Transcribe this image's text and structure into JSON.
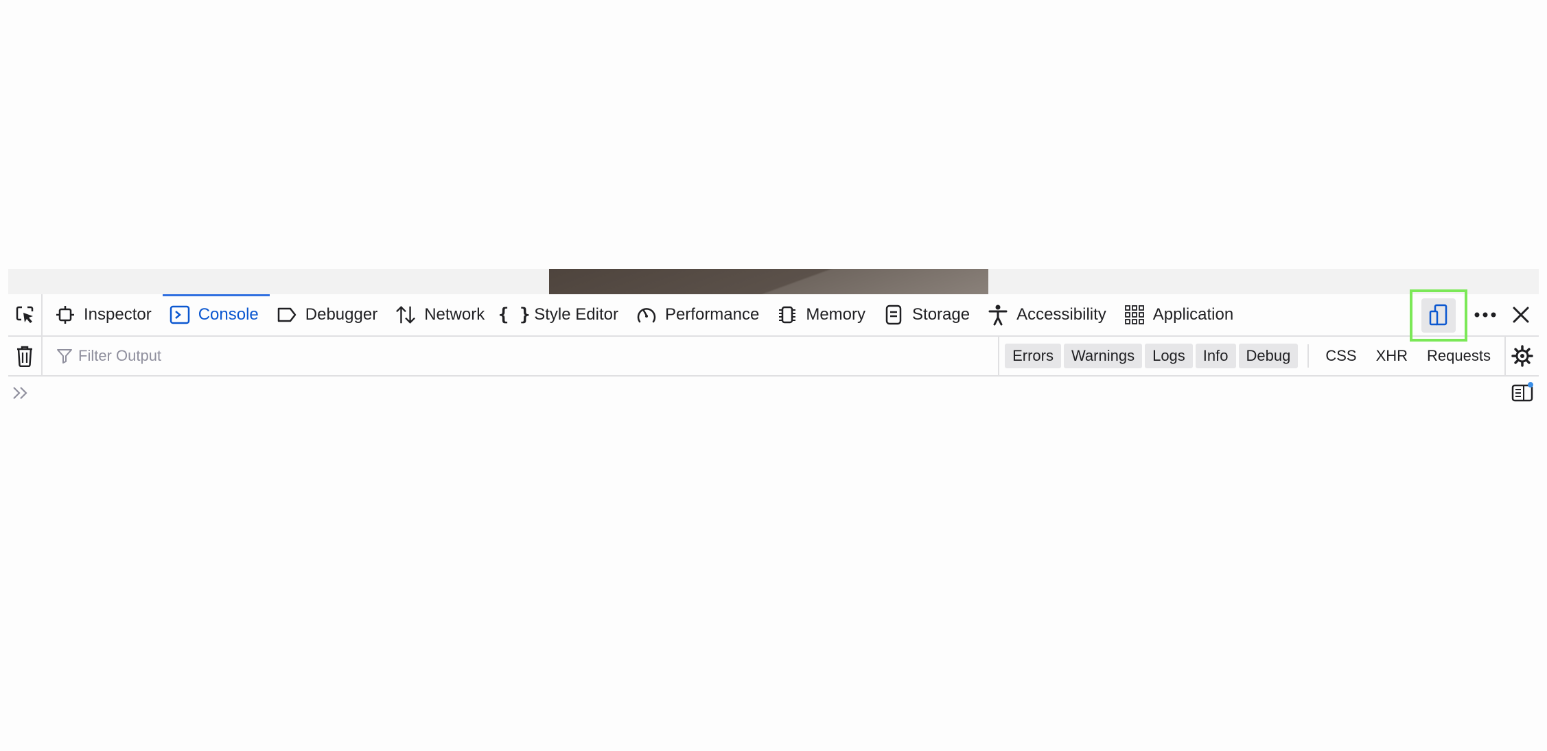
{
  "tabs": [
    {
      "label": "Inspector",
      "icon": "inspector-icon",
      "selected": false
    },
    {
      "label": "Console",
      "icon": "console-icon",
      "selected": true
    },
    {
      "label": "Debugger",
      "icon": "debugger-icon",
      "selected": false
    },
    {
      "label": "Network",
      "icon": "network-icon",
      "selected": false
    },
    {
      "label": "Style Editor",
      "icon": "style-editor-icon",
      "selected": false
    },
    {
      "label": "Performance",
      "icon": "performance-icon",
      "selected": false
    },
    {
      "label": "Memory",
      "icon": "memory-icon",
      "selected": false
    },
    {
      "label": "Storage",
      "icon": "storage-icon",
      "selected": false
    },
    {
      "label": "Accessibility",
      "icon": "accessibility-icon",
      "selected": false
    },
    {
      "label": "Application",
      "icon": "application-icon",
      "selected": false
    }
  ],
  "filter": {
    "placeholder": "Filter Output"
  },
  "levels": [
    "Errors",
    "Warnings",
    "Logs",
    "Info",
    "Debug"
  ],
  "request_filters": [
    "CSS",
    "XHR",
    "Requests"
  ],
  "colors": {
    "accent": "#0b57d0",
    "highlight_box": "#7be857",
    "notification_dot": "#3a8ee6"
  }
}
